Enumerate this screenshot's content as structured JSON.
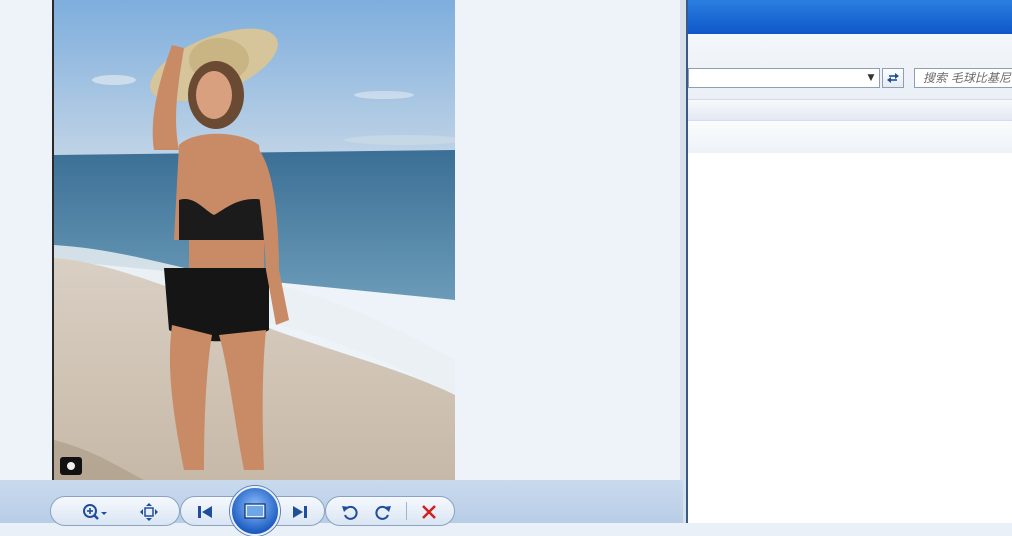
{
  "viewer": {
    "toolbar": {
      "zoom_icon": "zoom-magnifier-icon",
      "fit_icon": "fit-to-window-icon",
      "prev_icon": "previous-icon",
      "slideshow_icon": "slideshow-icon",
      "next_icon": "next-icon",
      "rotate_ccw_icon": "rotate-counterclockwise-icon",
      "rotate_cw_icon": "rotate-clockwise-icon",
      "delete_icon": "delete-icon"
    },
    "colors": {
      "accent": "#1f5fc2",
      "delete": "#d21f1f"
    }
  },
  "explorer": {
    "search": {
      "placeholder": "搜索 毛球比基尼"
    },
    "address": {
      "value": ""
    },
    "colors": {
      "titlebar": "#0e57c8"
    }
  }
}
